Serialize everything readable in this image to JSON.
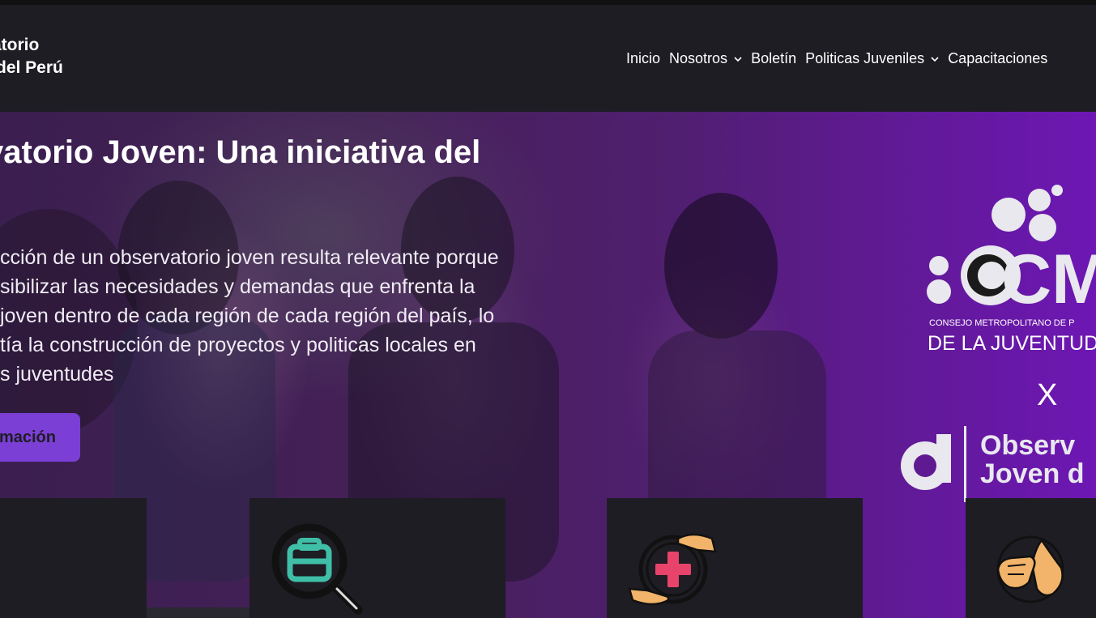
{
  "header": {
    "brand_line1": "atorio",
    "brand_line2": "del Perú"
  },
  "nav": {
    "items": [
      {
        "label": "Inicio",
        "has_dropdown": false
      },
      {
        "label": "Nosotros",
        "has_dropdown": true
      },
      {
        "label": "Boletín",
        "has_dropdown": false
      },
      {
        "label": "Politicas Juveniles",
        "has_dropdown": true
      },
      {
        "label": "Capacitaciones",
        "has_dropdown": false
      }
    ],
    "chevron": "⌄"
  },
  "hero": {
    "title": "vatorio Joven: Una iniciativa del",
    "text_lines": [
      "cción de un observatorio joven resulta relevante porque",
      "sibilizar las necesidades y demandas que enfrenta la",
      "joven dentro de cada región de cada región del país, lo",
      "tía la construcción de proyectos y politicas locales en",
      "s juventudes"
    ],
    "cta_label": "mación"
  },
  "logo": {
    "cm_text": "CM",
    "council_line": "CONSEJO METROPOLITANO DE P",
    "juventud_line": "DE LA JUVENTUD D",
    "x_mark": "X",
    "observatorio_line1": "Observ",
    "observatorio_line2": "Joven d"
  },
  "colors": {
    "accent": "#7b3fd6",
    "background": "#1e1d23",
    "teal_icon": "#3fbfa8",
    "pink_icon": "#e8436a",
    "skin_icon": "#f2b46a"
  },
  "cards": [
    {
      "icon": "briefcase-search-icon"
    },
    {
      "icon": "health-care-hands-icon"
    },
    {
      "icon": "sign-language-hands-icon"
    }
  ]
}
